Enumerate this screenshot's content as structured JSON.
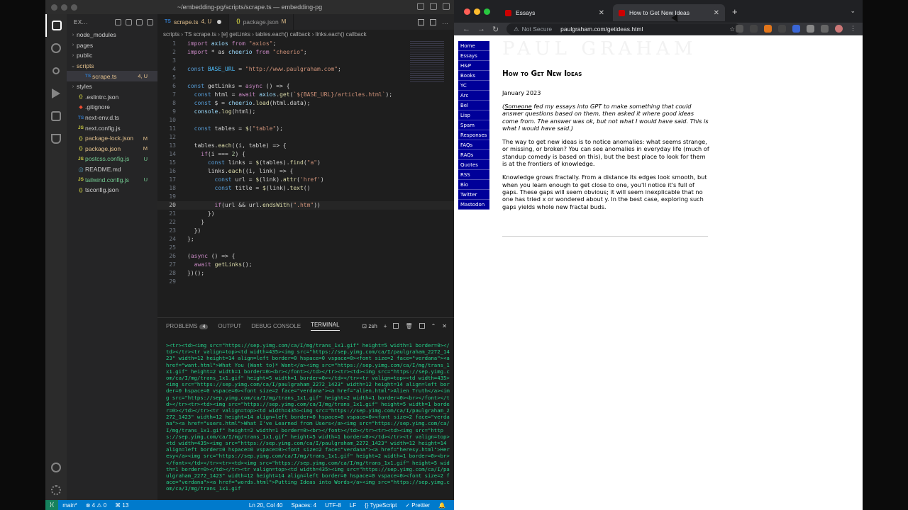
{
  "vscode": {
    "window_title": "~/embedding-pg/scripts/scrape.ts — embedding-pg",
    "explorer_title": "EX...",
    "files": [
      {
        "name": "node_modules",
        "type": "folder",
        "indent": 0,
        "status": ""
      },
      {
        "name": "pages",
        "type": "folder",
        "indent": 0,
        "status": ""
      },
      {
        "name": "public",
        "type": "folder",
        "indent": 0,
        "status": ""
      },
      {
        "name": "scripts",
        "type": "folder-open",
        "indent": 0,
        "status": ""
      },
      {
        "name": "scrape.ts",
        "type": "ts",
        "indent": 1,
        "status": "4, U",
        "active": true
      },
      {
        "name": "styles",
        "type": "folder",
        "indent": 0,
        "status": ""
      },
      {
        "name": ".eslintrc.json",
        "type": "json",
        "indent": 0,
        "status": ""
      },
      {
        "name": ".gitignore",
        "type": "git",
        "indent": 0,
        "status": ""
      },
      {
        "name": "next-env.d.ts",
        "type": "ts",
        "indent": 0,
        "status": ""
      },
      {
        "name": "next.config.js",
        "type": "js",
        "indent": 0,
        "status": ""
      },
      {
        "name": "package-lock.json",
        "type": "json",
        "indent": 0,
        "status": "M"
      },
      {
        "name": "package.json",
        "type": "json",
        "indent": 0,
        "status": "M"
      },
      {
        "name": "postcss.config.js",
        "type": "js",
        "indent": 0,
        "status": "U"
      },
      {
        "name": "README.md",
        "type": "md",
        "indent": 0,
        "status": ""
      },
      {
        "name": "tailwind.config.js",
        "type": "js",
        "indent": 0,
        "status": "U"
      },
      {
        "name": "tsconfig.json",
        "type": "json",
        "indent": 0,
        "status": ""
      }
    ],
    "tabs": [
      {
        "label": "scrape.ts",
        "status": "4, U",
        "active": true
      },
      {
        "label": "package.json",
        "status": "M",
        "active": false
      }
    ],
    "breadcrumb": "scripts › TS scrape.ts › [e] getLinks › tables.each() callback › links.each() callback",
    "code_lines": [
      "import axios from \"axios\";",
      "import * as cheerio from \"cheerio\";",
      "",
      "const BASE_URL = \"http://www.paulgraham.com\";",
      "",
      "const getLinks = async () => {",
      "  const html = await axios.get(`${BASE_URL}/articles.html`);",
      "  const $ = cheerio.load(html.data);",
      "  console.log(html);",
      "",
      "  const tables = $(\"table\");",
      "",
      "  tables.each((i, table) => {",
      "    if(i === 2) {",
      "      const links = $(tables).find(\"a\")",
      "      links.each((i, link) => {",
      "        const url = $(link).attr('href')",
      "        const title = $(link).text()",
      "",
      "        if(url && url.endsWith(\".htm\"))",
      "      })",
      "    }",
      "  })",
      "};",
      "",
      "(async () => {",
      "  await getLinks();",
      "})();",
      ""
    ],
    "current_line": 20,
    "panel_tabs": [
      "PROBLEMS",
      "OUTPUT",
      "DEBUG CONSOLE",
      "TERMINAL"
    ],
    "problems_count": "4",
    "active_panel": "TERMINAL",
    "shell": "zsh",
    "terminal_text": "><tr><td><img src=\"https://sep.yimg.com/ca/I/mg/trans_1x1.gif\" height=5 width=1 border=0></td></tr><tr valign=top><td width=435><img src=\"https://sep.yimg.com/ca/I/paulgraham_2272_1423\" width=12 height=14 align=left border=0 hspace=0 vspace=0><font size=2 face=\"verdana\"><a href=\"want.html\">What You (Want to)* Want</a><img src=\"https://sep.yimg.com/ca/I/mg/trans_1x1.gif\" height=2 width=1 border=0><br></font></td></tr><tr><td><img src=\"https://sep.yimg.com/ca/I/mg/trans_1x1.gif\" height=5 width=1 border=0></td></tr><tr valign=top><td width=435><img src=\"https://sep.yimg.com/ca/I/paulgraham_2272_1423\" width=12 height=14 align=left border=0 hspace=0 vspace=0><font size=2 face=\"verdana\"><a href=\"alien.html\">Alien Truth</a><img src=\"https://sep.yimg.com/ca/I/mg/trans_1x1.gif\" height=2 width=1 border=0><br></font></td></tr><tr><td><img src=\"https://sep.yimg.com/ca/I/mg/trans_1x1.gif\" height=5 width=1 border=0></td></tr><tr valign=top><td width=435><img src=\"https://sep.yimg.com/ca/I/paulgraham_2272_1423\" width=12 height=14 align=left border=0 hspace=0 vspace=0><font size=2 face=\"verdana\"><a href=\"users.html\">What I've Learned from Users</a><img src=\"https://sep.yimg.com/ca/I/mg/trans_1x1.gif\" height=2 width=1 border=0><br></font></td></tr><tr><td><img src=\"https://sep.yimg.com/ca/I/mg/trans_1x1.gif\" height=5 width=1 border=0></td></tr><tr valign=top><td width=435><img src=\"https://sep.yimg.com/ca/I/paulgraham_2272_1423\" width=12 height=14 align=left border=0 hspace=0 vspace=0><font size=2 face=\"verdana\"><a href=\"heresy.html\">Heresy</a><img src=\"https://sep.yimg.com/ca/I/mg/trans_1x1.gif\" height=2 width=1 border=0><br></font></td></tr><tr><td><img src=\"https://sep.yimg.com/ca/I/mg/trans_1x1.gif\" height=5 width=1 border=0></td></tr><tr valign=top><td width=435><img src=\"https://sep.yimg.com/ca/I/paulgraham_2272_1423\" width=12 height=14 align=left border=0 hspace=0 vspace=0><font size=2 face=\"verdana\"><a href=\"words.html\">Putting Ideas into Words</a><img src=\"https://sep.yimg.com/ca/I/mg/trans_1x1.gif",
    "status": {
      "branch": "main*",
      "errors": "⊗ 4 ⚠ 0",
      "ports": "⌘ 13",
      "position": "Ln 20, Col 40",
      "spaces": "Spaces: 4",
      "encoding": "UTF-8",
      "eol": "LF",
      "language": "{} TypeScript",
      "prettier": "✓ Prettier"
    }
  },
  "browser": {
    "tabs": [
      {
        "label": "Essays",
        "active": false
      },
      {
        "label": "How to Get New Ideas",
        "active": true
      }
    ],
    "security": "Not Secure",
    "url": "paulgraham.com/getideas.html",
    "site_logo": "PAUL GRAHAM",
    "nav_items": [
      "Home",
      "Essays",
      "H&P",
      "Books",
      "YC",
      "Arc",
      "Bel",
      "Lisp",
      "Spam",
      "Responses",
      "FAQs",
      "RAQs",
      "Quotes",
      "RSS",
      "Bio",
      "Twitter",
      "Mastodon"
    ],
    "article": {
      "title": "How to Get New Ideas",
      "date": "January 2023",
      "intro_link": "Someone",
      "intro_rest": " fed my essays into GPT to make something that could answer questions based on them, then asked it where good ideas come from. The answer was ok, but not what I would have said. This is what I would have said.)",
      "p1": "The way to get new ideas is to notice anomalies: what seems strange, or missing, or broken? You can see anomalies in everyday life (much of standup comedy is based on this), but the best place to look for them is at the frontiers of knowledge.",
      "p2": "Knowledge grows fractally. From a distance its edges look smooth, but when you learn enough to get close to one, you'll notice it's full of gaps. These gaps will seem obvious; it will seem inexplicable that no one has tried x or wondered about y. In the best case, exploring such gaps yields whole new fractal buds."
    }
  }
}
